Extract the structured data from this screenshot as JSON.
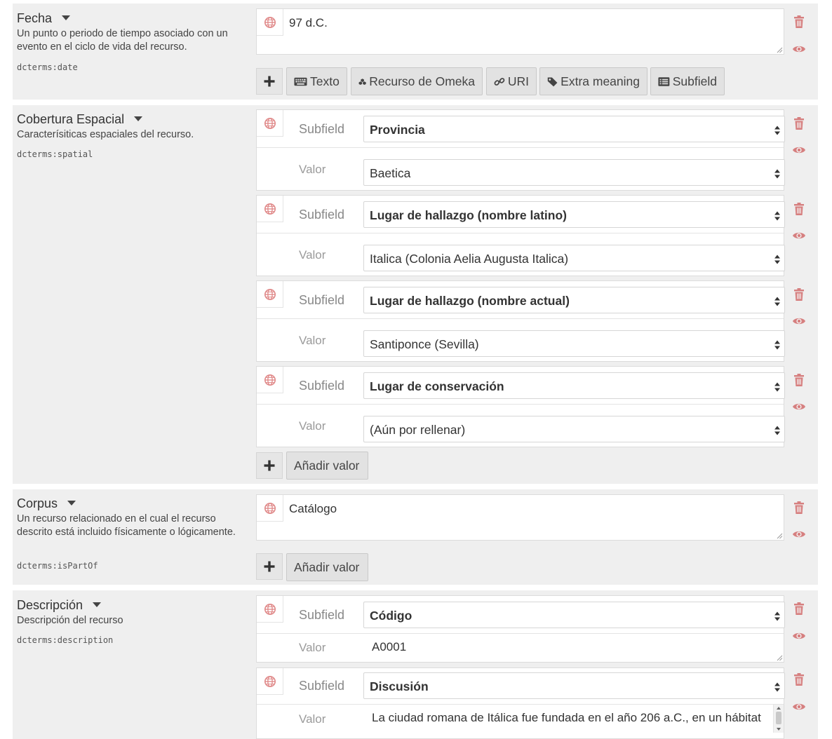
{
  "labels": {
    "subfield": "Subfield",
    "valor": "Valor"
  },
  "icons": {
    "trash": "trash-icon",
    "eye": "eye-icon",
    "globe": "globe-icon",
    "plus": "plus-icon"
  },
  "colors": {
    "icon_red": "#d67f7f",
    "section_bg": "#efefef"
  },
  "fecha": {
    "title": "Fecha",
    "description": "Un punto o periodo de tiempo asociado con un evento en el ciclo de vida del recurso.",
    "term": "dcterms:date",
    "value": "97 d.C.",
    "buttons": {
      "texto": "Texto",
      "omeka": "Recurso de Omeka",
      "uri": "URI",
      "extra": "Extra meaning",
      "subfield": "Subfield"
    }
  },
  "cobertura": {
    "title": "Cobertura Espacial",
    "description": "Caracterísiticas espaciales del recurso.",
    "term": "dcterms:spatial",
    "groups": [
      {
        "subfield": "Provincia",
        "value": "Baetica"
      },
      {
        "subfield": "Lugar de hallazgo (nombre latino)",
        "value": "Italica (Colonia Aelia Augusta Italica)"
      },
      {
        "subfield": "Lugar de hallazgo (nombre actual)",
        "value": "Santiponce (Sevilla)"
      },
      {
        "subfield": "Lugar de conservación",
        "value": "(Aún por rellenar)"
      }
    ],
    "add_label": "Añadir valor"
  },
  "corpus": {
    "title": "Corpus",
    "description": "Un recurso relacionado en el cual el recurso descrito está incluido físicamente o lógicamente.",
    "term": "dcterms:isPartOf",
    "value": "Catálogo",
    "add_label": "Añadir valor"
  },
  "descripcion": {
    "title": "Descripción",
    "description": "Descripción del recurso",
    "term": "dcterms:description",
    "groups": [
      {
        "subfield": "Código",
        "value": "A0001"
      },
      {
        "subfield": "Discusión",
        "value": "La ciudad romana de Itálica fue fundada en el año 206 a.C., en un hábitat"
      }
    ]
  }
}
